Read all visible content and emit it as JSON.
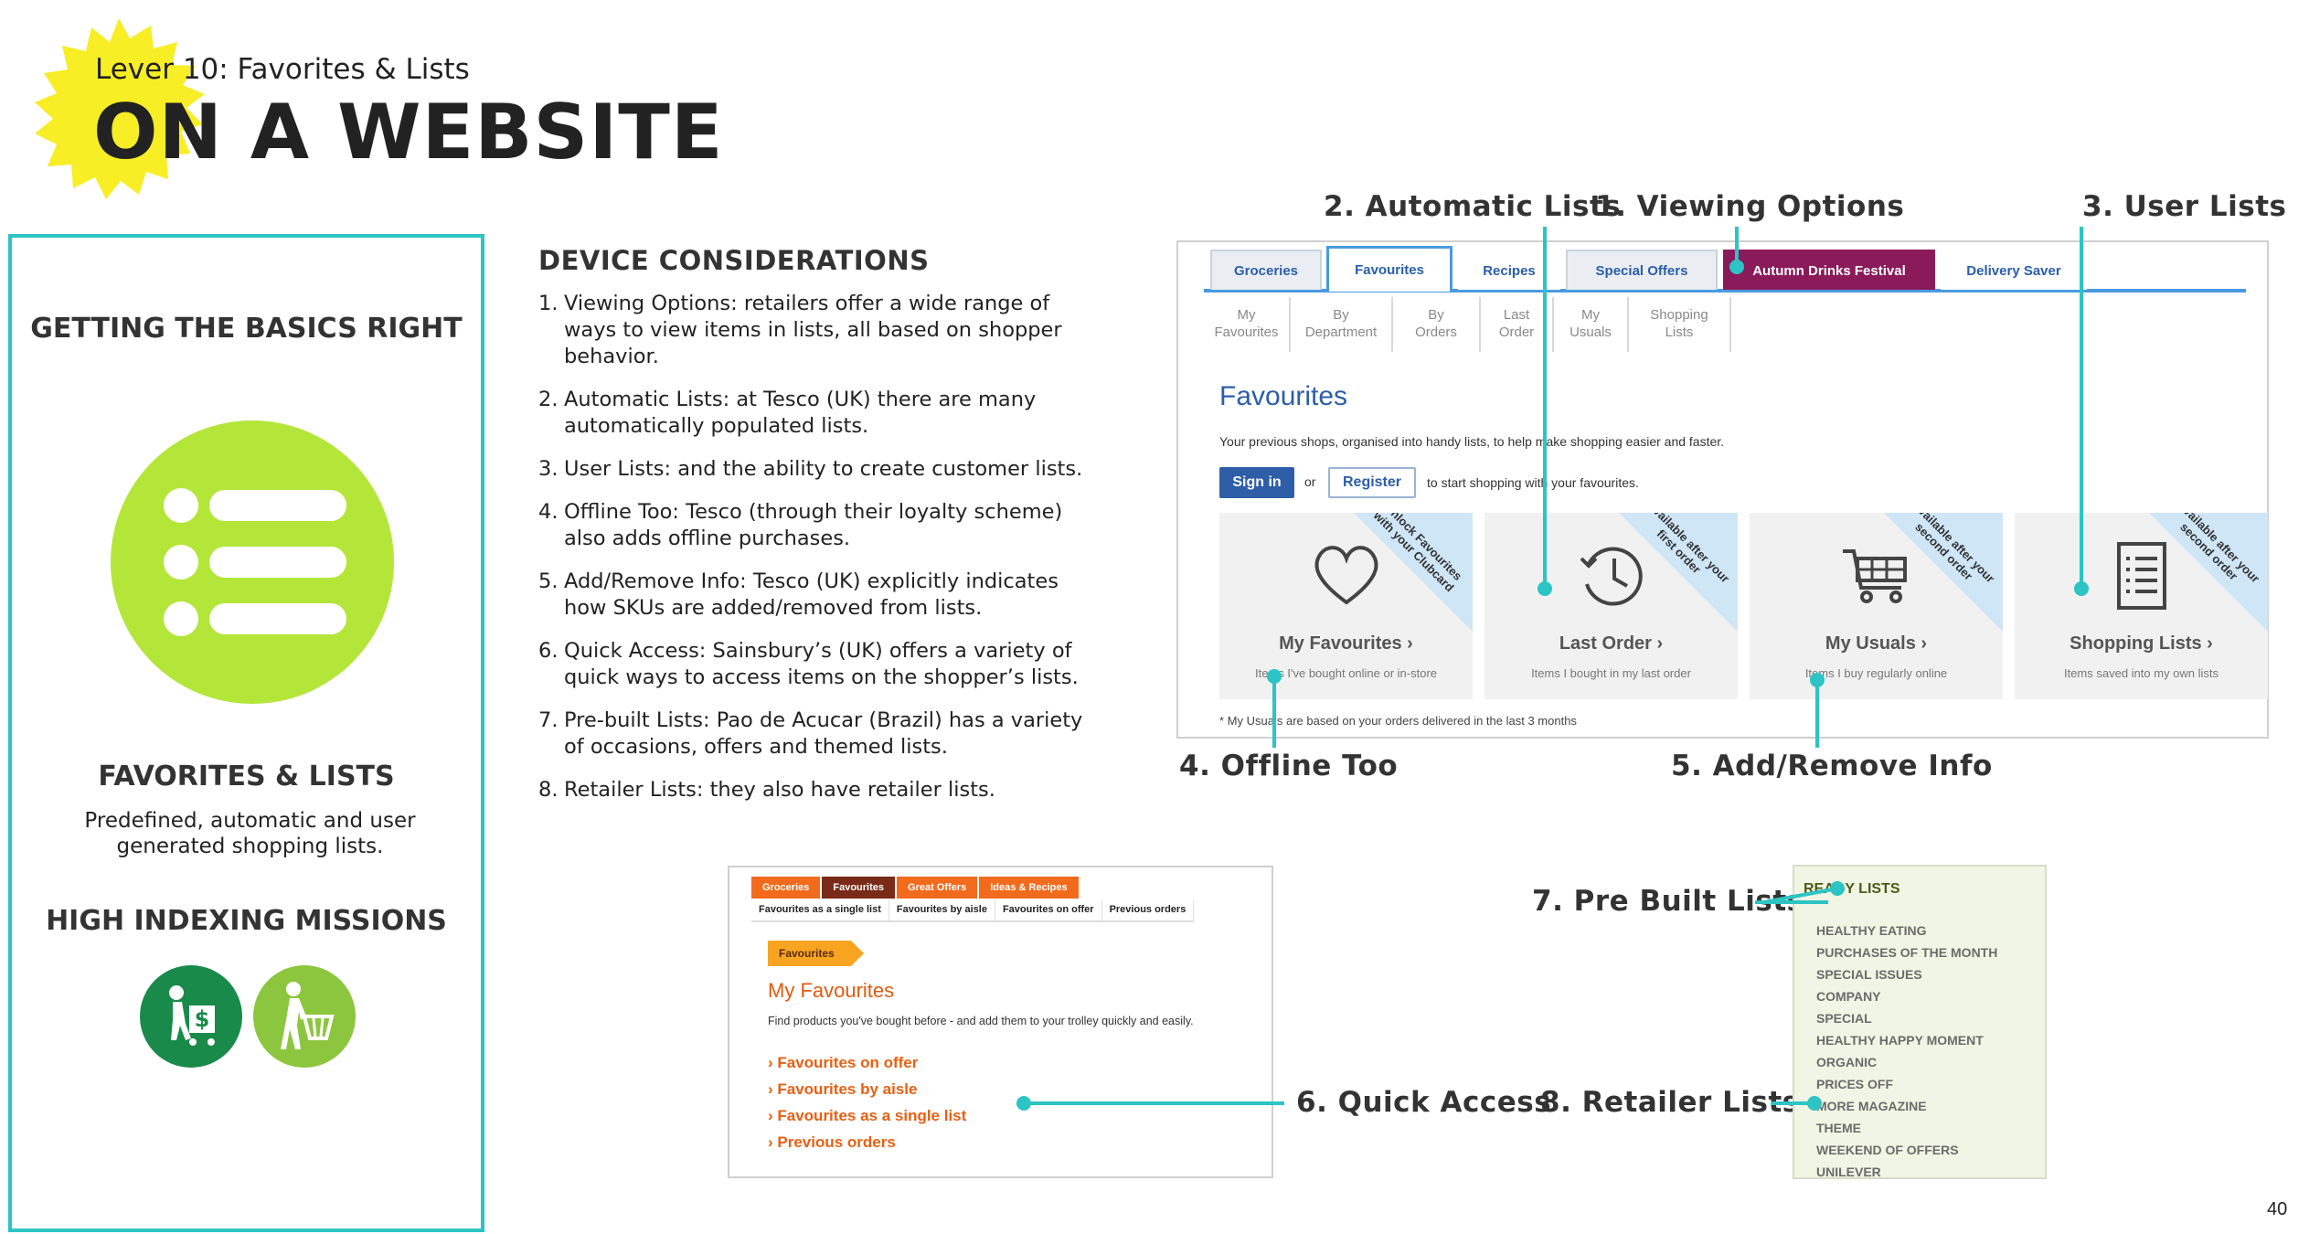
{
  "header": {
    "lever": "Lever 10: Favorites & Lists",
    "title": "ON A WEBSITE"
  },
  "left_panel": {
    "basics_heading": "GETTING THE BASICS RIGHT",
    "list_icon": "list-icon",
    "section_heading": "FAVORITES & LISTS",
    "section_desc": "Predefined, automatic and user generated shopping lists.",
    "missions_heading": "HIGH INDEXING MISSIONS",
    "mission_icons": [
      "shopper-with-cart-money-icon",
      "shopper-with-basket-icon"
    ],
    "colors": {
      "accent_border": "#2cc4c4",
      "icon_green": "#b4e63a",
      "dark_green": "#1a8a4a"
    }
  },
  "device_considerations": {
    "title": "DEVICE CONSIDERATIONS",
    "items": [
      {
        "num": "1.",
        "text": "Viewing Options: retailers offer a wide range of ways to view items in lists, all based on shopper behavior."
      },
      {
        "num": "2.",
        "text": "Automatic Lists: at Tesco (UK) there are many automatically populated lists."
      },
      {
        "num": "3.",
        "text": "User Lists: and the ability to create customer lists."
      },
      {
        "num": "4.",
        "text": "Offline Too: Tesco (through their loyalty scheme) also adds offline purchases."
      },
      {
        "num": "5.",
        "text": "Add/Remove Info: Tesco (UK) explicitly indicates how SKUs are added/removed from lists."
      },
      {
        "num": "6.",
        "text": "Quick Access: Sainsbury’s (UK) offers a variety of quick ways to access items on the shopper’s lists."
      },
      {
        "num": "7.",
        "text": "Pre-built Lists: Pao de Acucar (Brazil) has a variety of occasions, offers and themed lists."
      },
      {
        "num": "8.",
        "text": "Retailer Lists: they also have retailer lists."
      }
    ]
  },
  "callouts": {
    "c1": "1. Viewing Options",
    "c2": "2. Automatic Lists",
    "c3": "3. User Lists",
    "c4": "4. Offline Too",
    "c5": "5. Add/Remove Info",
    "c6": "6. Quick Access",
    "c7": "7. Pre Built Lists",
    "c8": "8. Retailer Lists"
  },
  "tesco": {
    "tabs": [
      "Groceries",
      "Favourites",
      "Recipes",
      "Special Offers",
      "Autumn Drinks Festival",
      "Delivery Saver"
    ],
    "subtabs": [
      {
        "line1": "My",
        "line2": "Favourites"
      },
      {
        "line1": "By",
        "line2": "Department"
      },
      {
        "line1": "By",
        "line2": "Orders"
      },
      {
        "line1": "Last",
        "line2": "Order"
      },
      {
        "line1": "My",
        "line2": "Usuals"
      },
      {
        "line1": "Shopping",
        "line2": "Lists"
      }
    ],
    "heading": "Favourites",
    "intro": "Your previous shops, organised into handy lists, to help make shopping easier and faster.",
    "sign_in": "Sign in",
    "or": "or",
    "register": "Register",
    "register_suffix": "to start shopping with your favourites.",
    "cards": [
      {
        "title": "My Favourites ›",
        "sub": "Items I've bought online or in-store",
        "corner": "Unlock Favourites with your Clubcard",
        "icon": "heart-icon"
      },
      {
        "title": "Last Order ›",
        "sub": "Items I bought in my last order",
        "corner": "Available after your first order",
        "icon": "history-clock-icon"
      },
      {
        "title": "My Usuals ›",
        "sub": "Items I buy regularly online",
        "corner": "Available after your second order",
        "icon": "trolley-icon"
      },
      {
        "title": "Shopping Lists ›",
        "sub": "Items saved into my own lists",
        "corner": "Available after your second order",
        "icon": "list-document-icon"
      }
    ],
    "footnote": "* My Usuals are based on your orders delivered in the last 3 months"
  },
  "sainsburys": {
    "tabs": [
      "Groceries",
      "Favourites",
      "Great Offers",
      "Ideas & Recipes"
    ],
    "subtabs": [
      "Favourites as a single list",
      "Favourites by aisle",
      "Favourites on offer",
      "Previous orders"
    ],
    "pill": "Favourites",
    "heading": "My Favourites",
    "intro": "Find products you've bought before - and add them to your trolley quickly and easily.",
    "links": [
      "› Favourites on offer",
      "› Favourites by aisle",
      "› Favourites as a single list",
      "› Previous orders"
    ]
  },
  "pao": {
    "title": "READY LISTS",
    "items": [
      "HEALTHY EATING",
      "PURCHASES OF THE MONTH",
      "SPECIAL ISSUES",
      "COMPANY",
      "SPECIAL",
      "HEALTHY HAPPY MOMENT",
      "ORGANIC",
      "PRICES OFF",
      "MORE MAGAZINE",
      "THEME",
      "WEEKEND OF OFFERS",
      "UNILEVER"
    ]
  },
  "page_number": "40"
}
